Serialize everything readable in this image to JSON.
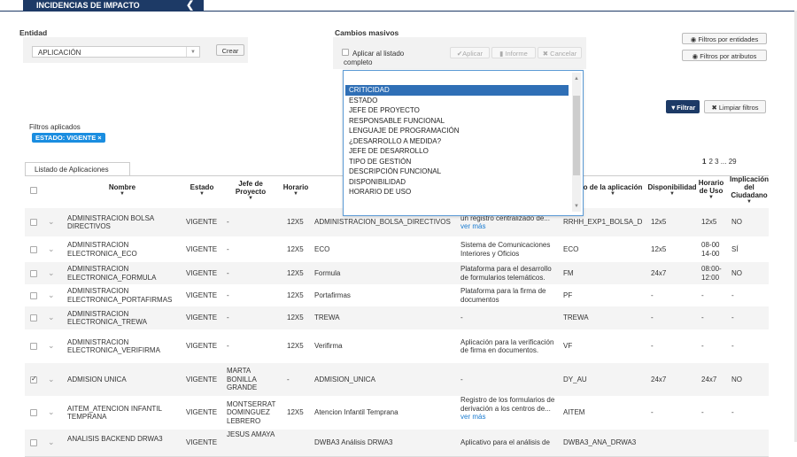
{
  "header": {
    "title": "INCIDENCIAS DE IMPACTO",
    "collapse_icon": "chevron-left-icon"
  },
  "entidad": {
    "label": "Entidad",
    "selected": "APLICACIÓN",
    "crear_label": "Crear"
  },
  "cambios": {
    "label": "Cambios masivos",
    "aplicar_listado": "Aplicar al listado completo",
    "aplicar_label": "Aplicar",
    "informe_label": "Informe",
    "cancelar_label": "Cancelar"
  },
  "filters": {
    "por_entidades": "Filtros por entidades",
    "por_atributos": "Filtros por atributos",
    "filtrar": "Filtrar",
    "limpiar": "Limpiar filtros",
    "aplicados_label": "Filtros aplicados",
    "tag": "ESTADO: VIGENTE ×"
  },
  "dropdown": {
    "items": [
      "CRITICIDAD",
      "ESTADO",
      "JEFE DE PROYECTO",
      "RESPONSABLE FUNCIONAL",
      "LENGUAJE DE PROGRAMACIÓN",
      "¿DESARROLLO A MEDIDA?",
      "JEFE DE DESARROLLO",
      "TIPO DE GESTIÓN",
      "DESCRIPCIÓN FUNCIONAL",
      "DISPONIBILIDAD",
      "HORARIO DE USO"
    ],
    "selected_index": 0
  },
  "table": {
    "tab_label": "Listado de Aplicaciones",
    "pager": {
      "current": "1",
      "pages": "2 3 ... 29"
    },
    "headers": {
      "nombre": "Nombre",
      "estado": "Estado",
      "jefe": "Jefe de Proyecto",
      "horario": "Horario",
      "codigo": "o de la aplicación",
      "disponibilidad": "Disponibilidad",
      "horario_uso": "Horario de Uso",
      "implicacion": "Implicación del Ciudadano"
    },
    "ver_mas": "ver más",
    "rows": [
      {
        "nombre": "ADMINISTRACION BOLSA DIRECTIVOS",
        "estado": "VIGENTE",
        "jefe": "-",
        "horario": "12X5",
        "alias": "ADMINISTRACION_BOLSA_DIRECTIVOS",
        "desc": "un registro centralizado de...",
        "desc_more": "ver más",
        "codigo": "RRHH_EXP1_BOLSA_D",
        "disp": "12x5",
        "uso": "12x5",
        "impl": "NO",
        "checked": false
      },
      {
        "nombre": "ADMINISTRACION ELECTRONICA_ECO",
        "estado": "VIGENTE",
        "jefe": "-",
        "horario": "12X5",
        "alias": "ECO",
        "desc": "Sistema de Comunicaciones Interiores y Oficios",
        "desc_more": "",
        "codigo": "ECO",
        "disp": "12x5",
        "uso": "08-00 14-00",
        "impl": "SÍ",
        "checked": false
      },
      {
        "nombre": "ADMINISTRACION ELECTRONICA_FORMULA",
        "estado": "VIGENTE",
        "jefe": "-",
        "horario": "12X5",
        "alias": "Formula",
        "desc": "Plataforma para el desarrollo de formularios telemáticos.",
        "desc_more": "",
        "codigo": "FM",
        "disp": "24x7",
        "uso": "08:00-12:00",
        "impl": "NO",
        "checked": false
      },
      {
        "nombre": "ADMINISTRACION ELECTRONICA_PORTAFIRMAS",
        "estado": "VIGENTE",
        "jefe": "-",
        "horario": "12X5",
        "alias": "Portafirmas",
        "desc": "Plataforma para la firma de documentos",
        "desc_more": "",
        "codigo": "PF",
        "disp": "-",
        "uso": "-",
        "impl": "-",
        "checked": false
      },
      {
        "nombre": "ADMINISTRACION ELECTRONICA_TREWA",
        "estado": "VIGENTE",
        "jefe": "-",
        "horario": "12X5",
        "alias": "TREWA",
        "desc": "-",
        "desc_more": "",
        "codigo": "TREWA",
        "disp": "-",
        "uso": "-",
        "impl": "-",
        "checked": false
      },
      {
        "nombre": "ADMINISTRACION ELECTRONICA_VERIFIRMA",
        "estado": "VIGENTE",
        "jefe": "-",
        "horario": "12X5",
        "alias": "Verifirma",
        "desc": "Aplicación para la verificación de firma en documentos.",
        "desc_more": "",
        "codigo": "VF",
        "disp": "-",
        "uso": "-",
        "impl": "-",
        "checked": false
      },
      {
        "nombre": "ADMISION UNICA",
        "estado": "VIGENTE",
        "jefe": "MARTA BONILLA GRANDE",
        "horario": "-",
        "alias": "ADMISION_UNICA",
        "desc": "-",
        "desc_more": "",
        "codigo": "DY_AU",
        "disp": "24x7",
        "uso": "24x7",
        "impl": "NO",
        "checked": true
      },
      {
        "nombre": "AITEM_ATENCION INFANTIL TEMPRANA",
        "estado": "VIGENTE",
        "jefe": "MONTSERRAT DOMINGUEZ LEBRERO",
        "horario": "12X5",
        "alias": "Atencion Infantil Temprana",
        "desc": "Registro de los formularios de derivación a los centros de...",
        "desc_more": "ver más",
        "codigo": "AITEM",
        "disp": "-",
        "uso": "-",
        "impl": "-",
        "checked": false
      },
      {
        "nombre": "ANALISIS BACKEND DRWA3",
        "estado": "VIGENTE",
        "jefe": "JESUS AMAYA",
        "horario": "",
        "alias": "DWBA3 Análisis DRWA3",
        "desc": "Aplicativo para el análisis de",
        "desc_more": "",
        "codigo": "DWBA3_ANA_DRWA3",
        "disp": "",
        "uso": "",
        "impl": "",
        "checked": false
      }
    ]
  }
}
